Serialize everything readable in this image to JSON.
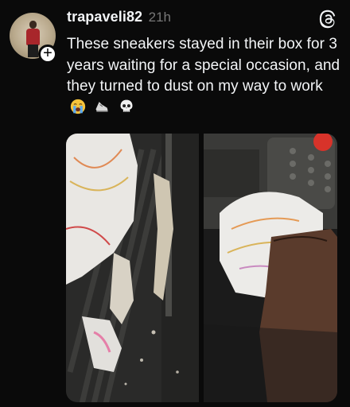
{
  "post": {
    "username": "trapaveli82",
    "time": "21h",
    "text": "These sneakers stayed in their box for 3 years waiting for a special occasion, and they turned to dust on my way to work",
    "emojis": [
      "crying-face",
      "sneaker",
      "skull"
    ],
    "follow_symbol": "+"
  },
  "icons": {
    "brand": "threads-logo",
    "avatar": "profile-avatar"
  },
  "colors": {
    "background": "#0a0a0a",
    "text": "#f3f5f7",
    "muted": "#777777"
  },
  "media": {
    "count": 2,
    "items": [
      "crumbling-sneaker-photo",
      "sneaker-on-pedal-photo"
    ]
  }
}
